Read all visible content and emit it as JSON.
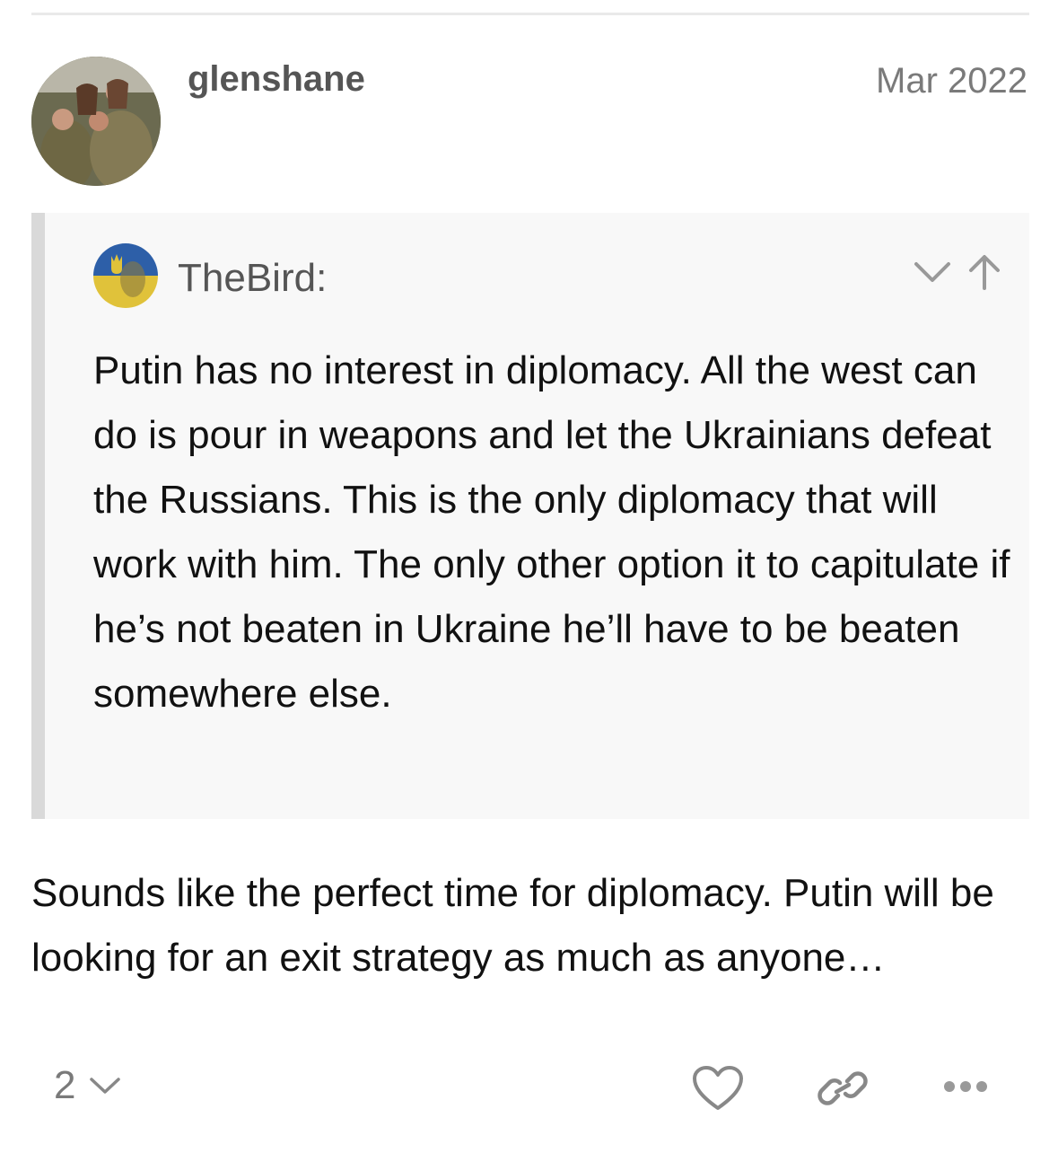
{
  "post": {
    "username": "glenshane",
    "date": "Mar 2022",
    "avatar_icon": "user-avatar-photo",
    "quote": {
      "author": "TheBird:",
      "avatar_icon": "ukraine-flag-avatar",
      "controls": [
        "chevron-down-icon",
        "arrow-up-icon"
      ],
      "text": "Putin has no interest in diplomacy. All the west can do is pour in weapons and let the Ukrainians defeat the Russians. This is the only diplomacy that will work with him. The only other option it to capitulate if he’s not beaten in Ukraine he’ll have to be beaten somewhere else."
    },
    "body": "Sounds like the perfect time for diplomacy. Putin will be looking for an exit strategy as much as anyone…"
  },
  "actions": {
    "reply_count": "2",
    "icons": [
      "chevron-down-icon",
      "heart-icon",
      "link-icon",
      "more-icon"
    ]
  },
  "colors": {
    "quote_background": "#f8f8f8",
    "quote_border": "#d9d9d9",
    "muted_text": "#7a7a7a",
    "username_text": "#555555"
  }
}
